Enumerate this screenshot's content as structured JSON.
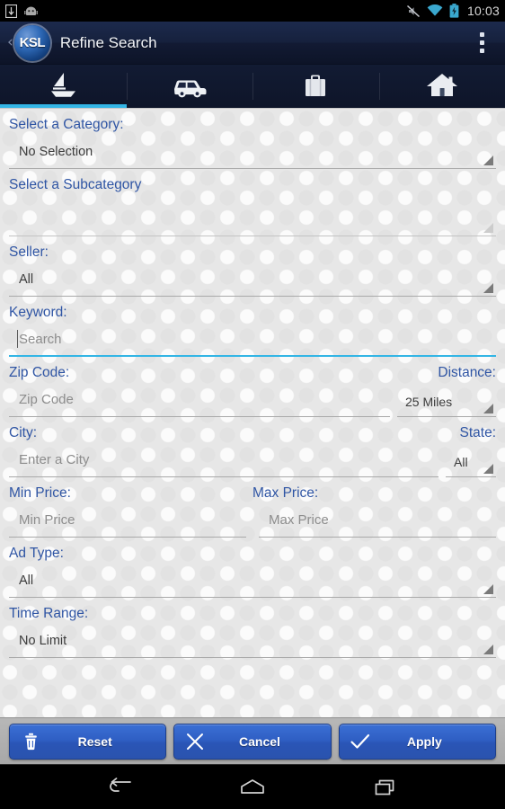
{
  "statusbar": {
    "time": "10:03",
    "left_icons": [
      "sd-card-icon",
      "android-robot-icon"
    ],
    "right_icons": [
      "silent-mode-icon",
      "wifi-icon",
      "battery-charging-icon"
    ]
  },
  "actionbar": {
    "back_chevron": "‹",
    "logo_text": "KSL",
    "title": "Refine Search",
    "overflow_icon": "overflow-menu-icon"
  },
  "tabs": [
    {
      "name": "boat",
      "icon": "sailboat-icon",
      "selected": true
    },
    {
      "name": "cars",
      "icon": "car-icon",
      "selected": false
    },
    {
      "name": "jobs",
      "icon": "briefcase-icon",
      "selected": false
    },
    {
      "name": "homes",
      "icon": "house-icon",
      "selected": false
    }
  ],
  "accent": {
    "tab_underline": "#33b5e5",
    "label_blue": "#2f55a4",
    "button_blue": "#2f5fc4",
    "focus_cyan": "#33b5e5"
  },
  "form": {
    "category": {
      "label": "Select a Category:",
      "value": "No Selection"
    },
    "subcategory": {
      "label": "Select a Subcategory",
      "value": ""
    },
    "seller": {
      "label": "Seller:",
      "value": "All"
    },
    "keyword": {
      "label": "Keyword:",
      "placeholder": "Search",
      "value": ""
    },
    "zip": {
      "label": "Zip Code:",
      "placeholder": "Zip Code",
      "value": ""
    },
    "distance": {
      "label": "Distance:",
      "value": "25 Miles"
    },
    "city": {
      "label": "City:",
      "placeholder": "Enter a City",
      "value": ""
    },
    "state": {
      "label": "State:",
      "value": "All"
    },
    "min_price": {
      "label": "Min Price:",
      "placeholder": "Min Price",
      "value": ""
    },
    "max_price": {
      "label": "Max Price:",
      "placeholder": "Max Price",
      "value": ""
    },
    "ad_type": {
      "label": "Ad Type:",
      "value": "All"
    },
    "time_range": {
      "label": "Time Range:",
      "value": "No Limit"
    }
  },
  "buttons": {
    "reset": {
      "label": "Reset",
      "icon": "trash-icon"
    },
    "cancel": {
      "label": "Cancel",
      "icon": "close-x-icon"
    },
    "apply": {
      "label": "Apply",
      "icon": "checkmark-icon"
    }
  },
  "navbar": {
    "back": "back-icon",
    "home": "home-icon",
    "recents": "recents-icon"
  }
}
